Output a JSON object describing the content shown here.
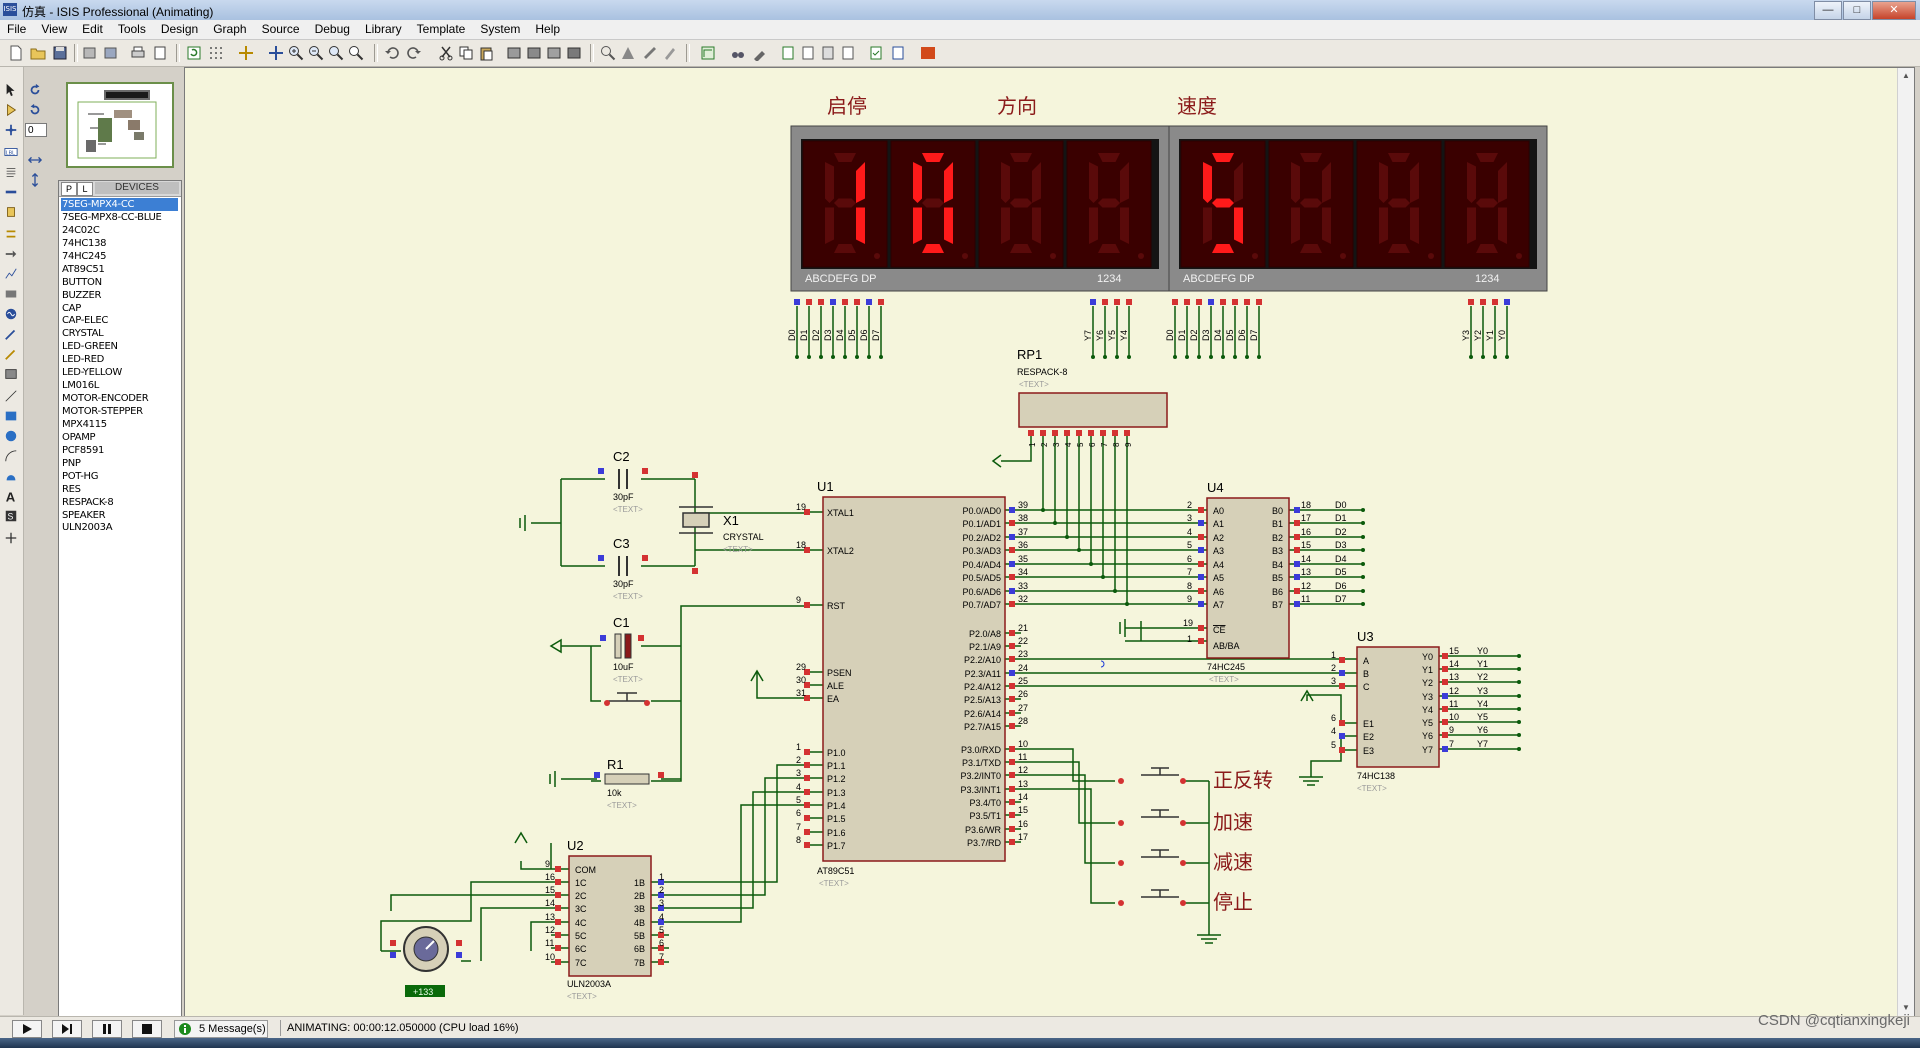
{
  "window": {
    "title": "仿真 - ISIS Professional (Animating)",
    "app_icon_text": "ISIS",
    "minimize": "—",
    "maximize": "□",
    "close": "✕"
  },
  "menu": [
    "File",
    "View",
    "Edit",
    "Tools",
    "Design",
    "Graph",
    "Source",
    "Debug",
    "Library",
    "Template",
    "System",
    "Help"
  ],
  "rotation": {
    "value": "0"
  },
  "device_panel": {
    "tab_p": "P",
    "tab_l": "L",
    "header": "DEVICES",
    "items": [
      "7SEG-MPX4-CC",
      "7SEG-MPX8-CC-BLUE",
      "24C02C",
      "74HC138",
      "74HC245",
      "AT89C51",
      "BUTTON",
      "BUZZER",
      "CAP",
      "CAP-ELEC",
      "CRYSTAL",
      "LED-GREEN",
      "LED-RED",
      "LED-YELLOW",
      "LM016L",
      "MOTOR-ENCODER",
      "MOTOR-STEPPER",
      "MPX4115",
      "OPAMP",
      "PCF8591",
      "PNP",
      "POT-HG",
      "RES",
      "RESPACK-8",
      "SPEAKER",
      "ULN2003A"
    ],
    "selected_index": 0
  },
  "schematic": {
    "labels": {
      "start_stop": "启停",
      "direction": "方向",
      "speed": "速度"
    },
    "display_left": {
      "digits": [
        "1",
        "0",
        "",
        ""
      ],
      "pin_label": "ABCDEFG  DP",
      "digit_label": "1234"
    },
    "display_right": {
      "digits": [
        "5",
        "",
        "",
        ""
      ],
      "pin_label": "ABCDEFG  DP",
      "digit_label": "1234"
    },
    "data_pins": [
      "D0",
      "D1",
      "D2",
      "D3",
      "D4",
      "D5",
      "D6",
      "D7"
    ],
    "left_sel_pins": [
      "Y7",
      "Y6",
      "Y5",
      "Y4"
    ],
    "right_sel_pins": [
      "Y3",
      "Y2",
      "Y1",
      "Y0"
    ],
    "rp1": {
      "ref": "RP1",
      "part": "RESPACK-8",
      "text": "<TEXT>",
      "pins": [
        "1",
        "2",
        "3",
        "4",
        "5",
        "6",
        "7",
        "8",
        "9"
      ]
    },
    "c2": {
      "ref": "C2",
      "value": "30pF",
      "text": "<TEXT>"
    },
    "c3": {
      "ref": "C3",
      "value": "30pF",
      "text": "<TEXT>"
    },
    "x1": {
      "ref": "X1",
      "part": "CRYSTAL",
      "text": "<TEXT>"
    },
    "c1": {
      "ref": "C1",
      "value": "10uF",
      "text": "<TEXT>"
    },
    "r1": {
      "ref": "R1",
      "value": "10k",
      "text": "<TEXT>"
    },
    "u1": {
      "ref": "U1",
      "part": "AT89C51",
      "text": "<TEXT>",
      "left_pins": [
        [
          "19",
          "XTAL1"
        ],
        [
          "18",
          "XTAL2"
        ],
        [
          "9",
          "RST"
        ],
        [
          "29",
          "PSEN"
        ],
        [
          "30",
          "ALE"
        ],
        [
          "31",
          "EA"
        ],
        [
          "1",
          "P1.0"
        ],
        [
          "2",
          "P1.1"
        ],
        [
          "3",
          "P1.2"
        ],
        [
          "4",
          "P1.3"
        ],
        [
          "5",
          "P1.4"
        ],
        [
          "6",
          "P1.5"
        ],
        [
          "7",
          "P1.6"
        ],
        [
          "8",
          "P1.7"
        ]
      ],
      "right_pins": [
        [
          "39",
          "P0.0/AD0"
        ],
        [
          "38",
          "P0.1/AD1"
        ],
        [
          "37",
          "P0.2/AD2"
        ],
        [
          "36",
          "P0.3/AD3"
        ],
        [
          "35",
          "P0.4/AD4"
        ],
        [
          "34",
          "P0.5/AD5"
        ],
        [
          "33",
          "P0.6/AD6"
        ],
        [
          "32",
          "P0.7/AD7"
        ],
        [
          "21",
          "P2.0/A8"
        ],
        [
          "22",
          "P2.1/A9"
        ],
        [
          "23",
          "P2.2/A10"
        ],
        [
          "24",
          "P2.3/A11"
        ],
        [
          "25",
          "P2.4/A12"
        ],
        [
          "26",
          "P2.5/A13"
        ],
        [
          "27",
          "P2.6/A14"
        ],
        [
          "28",
          "P2.7/A15"
        ],
        [
          "10",
          "P3.0/RXD"
        ],
        [
          "11",
          "P3.1/TXD"
        ],
        [
          "12",
          "P3.2/INT0"
        ],
        [
          "13",
          "P3.3/INT1"
        ],
        [
          "14",
          "P3.4/T0"
        ],
        [
          "15",
          "P3.5/T1"
        ],
        [
          "16",
          "P3.6/WR"
        ],
        [
          "17",
          "P3.7/RD"
        ]
      ]
    },
    "u4": {
      "ref": "U4",
      "part": "74HC245",
      "text": "<TEXT>",
      "a_pins": [
        [
          "2",
          "A0"
        ],
        [
          "3",
          "A1"
        ],
        [
          "4",
          "A2"
        ],
        [
          "5",
          "A3"
        ],
        [
          "6",
          "A4"
        ],
        [
          "7",
          "A5"
        ],
        [
          "8",
          "A6"
        ],
        [
          "9",
          "A7"
        ]
      ],
      "b_pins": [
        [
          "18",
          "B0",
          "D0"
        ],
        [
          "17",
          "B1",
          "D1"
        ],
        [
          "16",
          "B2",
          "D2"
        ],
        [
          "15",
          "B3",
          "D3"
        ],
        [
          "14",
          "B4",
          "D4"
        ],
        [
          "13",
          "B5",
          "D5"
        ],
        [
          "12",
          "B6",
          "D6"
        ],
        [
          "11",
          "B7",
          "D7"
        ]
      ],
      "ce_pin": [
        "19",
        "CE"
      ],
      "dir_pin": [
        "1",
        "AB/BA"
      ]
    },
    "u3": {
      "ref": "U3",
      "part": "74HC138",
      "text": "<TEXT>",
      "in_pins": [
        [
          "1",
          "A"
        ],
        [
          "2",
          "B"
        ],
        [
          "3",
          "C"
        ]
      ],
      "en_pins": [
        [
          "6",
          "E1"
        ],
        [
          "4",
          "E2"
        ],
        [
          "5",
          "E3"
        ]
      ],
      "out_pins": [
        [
          "15",
          "Y0"
        ],
        [
          "14",
          "Y1"
        ],
        [
          "13",
          "Y2"
        ],
        [
          "12",
          "Y3"
        ],
        [
          "11",
          "Y4"
        ],
        [
          "10",
          "Y5"
        ],
        [
          "9",
          "Y6"
        ],
        [
          "7",
          "Y7"
        ]
      ]
    },
    "u2": {
      "ref": "U2",
      "part": "ULN2003A",
      "text": "<TEXT>",
      "left_pins": [
        [
          "9",
          "COM"
        ],
        [
          "16",
          "1C"
        ],
        [
          "15",
          "2C"
        ],
        [
          "14",
          "3C"
        ],
        [
          "13",
          "4C"
        ],
        [
          "12",
          "5C"
        ],
        [
          "11",
          "6C"
        ],
        [
          "10",
          "7C"
        ]
      ],
      "right_pins": [
        [
          "1",
          "1B"
        ],
        [
          "2",
          "2B"
        ],
        [
          "3",
          "3B"
        ],
        [
          "4",
          "4B"
        ],
        [
          "5",
          "5B"
        ],
        [
          "6",
          "6B"
        ],
        [
          "7",
          "7B"
        ]
      ]
    },
    "motor": {
      "readout": "+133"
    },
    "buttons": [
      "正反转",
      "加速",
      "减速",
      "停止"
    ]
  },
  "status": {
    "messages": "5 Message(s)",
    "animating": "ANIMATING: 00:00:12.050000 (CPU load 16%)"
  },
  "watermark": "CSDN @cqtianxingkeji"
}
